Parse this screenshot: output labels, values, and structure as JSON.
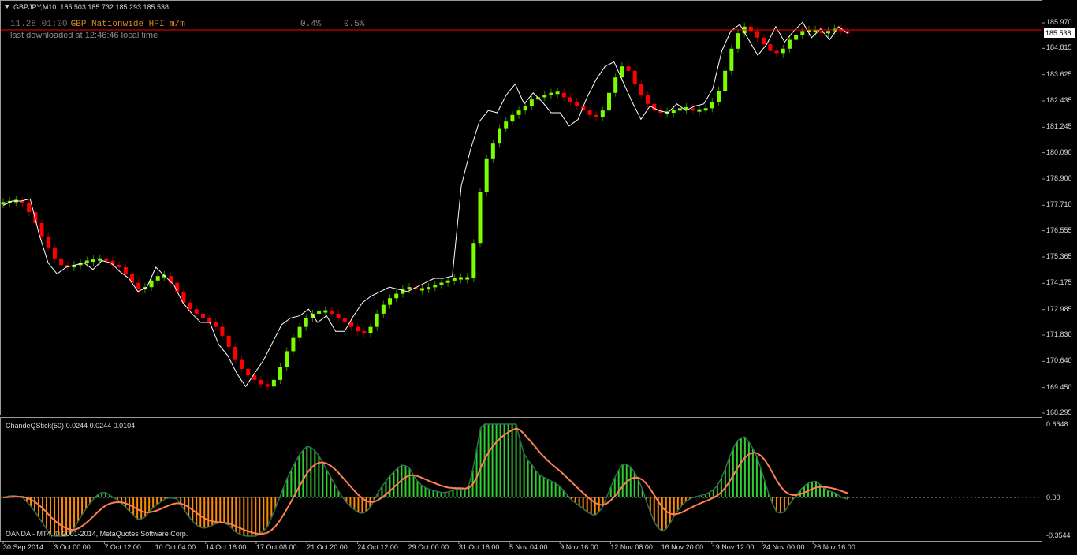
{
  "chart_header": {
    "symbol_timeframe": "GBPJPY,M10",
    "ohlc": "185.503 185.732 185.293 185.538"
  },
  "news": {
    "datetime": "11.28 01:00",
    "event": "GBP Nationwide HPI m/m",
    "actual": "0.4%",
    "forecast": "0.5%"
  },
  "download_status": "last downloaded at 12:46:46 local time",
  "indicator": {
    "name": "ChandeQStick(50)",
    "values": "0.0244 0.0244 0.0104",
    "scale_labels": [
      "0.6648",
      "0.00",
      "-0.3544"
    ]
  },
  "footer": "OANDA - MT4, © 2001-2014, MetaQuotes Software Corp.",
  "current_price": "185.538",
  "colors": {
    "bull": "#7cfc00",
    "bear": "#ff0000",
    "price_line": "#ffffff",
    "bid_line": "#ff0000",
    "hist_pos": "#32cd32",
    "hist_neg": "#ff8c00",
    "signal": "#ff7f50"
  },
  "chart_data": {
    "type": "line",
    "price_axis": [
      185.97,
      184.815,
      183.625,
      182.435,
      181.245,
      180.09,
      178.9,
      177.71,
      176.555,
      175.365,
      174.175,
      172.985,
      171.83,
      170.64,
      169.45,
      168.295
    ],
    "ylim": [
      168.295,
      185.97
    ],
    "time_axis": [
      "30 Sep 2014",
      "3 Oct 00:00",
      "7 Oct 12:00",
      "10 Oct 04:00",
      "14 Oct 16:00",
      "17 Oct 08:00",
      "21 Oct 20:00",
      "24 Oct 12:00",
      "29 Oct 00:00",
      "31 Oct 16:00",
      "5 Nov 04:00",
      "9 Nov 16:00",
      "12 Nov 08:00",
      "16 Nov 20:00",
      "19 Nov 12:00",
      "24 Nov 00:00",
      "26 Nov 16:00"
    ],
    "smoothed_candles": [
      177.8,
      177.9,
      177.9,
      177.8,
      177.4,
      176.9,
      176.3,
      175.8,
      175.3,
      175.0,
      174.9,
      175.0,
      175.1,
      175.2,
      175.2,
      175.3,
      175.2,
      175.0,
      174.9,
      174.6,
      174.2,
      173.9,
      174.0,
      174.3,
      174.5,
      174.5,
      174.2,
      173.8,
      173.3,
      173.0,
      172.8,
      172.6,
      172.4,
      172.2,
      171.8,
      171.3,
      170.7,
      170.3,
      170.0,
      169.8,
      169.6,
      169.5,
      169.8,
      170.4,
      171.1,
      171.7,
      172.2,
      172.6,
      172.8,
      172.9,
      172.9,
      172.8,
      172.6,
      172.4,
      172.2,
      172.0,
      171.9,
      172.2,
      172.8,
      173.2,
      173.5,
      173.7,
      173.9,
      174.0,
      173.9,
      173.9,
      174.0,
      174.1,
      174.2,
      174.3,
      174.4,
      174.4,
      174.4,
      176.0,
      178.3,
      179.8,
      180.5,
      181.2,
      181.5,
      181.8,
      182.0,
      182.2,
      182.5,
      182.6,
      182.7,
      182.8,
      182.8,
      182.6,
      182.4,
      182.2,
      182.0,
      181.8,
      181.7,
      182.0,
      182.8,
      183.5,
      184.0,
      183.8,
      183.2,
      182.7,
      182.3,
      182.0,
      181.9,
      181.9,
      182.0,
      182.1,
      182.1,
      182.0,
      182.0,
      182.1,
      182.4,
      182.9,
      183.8,
      184.8,
      185.5,
      185.8,
      185.6,
      185.3,
      185.0,
      184.7,
      184.6,
      184.8,
      185.2,
      185.4,
      185.6,
      185.6,
      185.6,
      185.5,
      185.6,
      185.7,
      185.6,
      185.5
    ],
    "close_line": [
      177.7,
      177.9,
      177.9,
      178.0,
      176.4,
      175.1,
      174.6,
      174.9,
      175.0,
      175.1,
      174.8,
      175.2,
      175.1,
      174.7,
      174.4,
      173.8,
      174.0,
      174.9,
      174.5,
      174.1,
      173.3,
      172.8,
      172.4,
      172.4,
      171.4,
      170.9,
      170.1,
      169.5,
      170.1,
      170.7,
      171.5,
      172.3,
      172.6,
      172.7,
      173.0,
      172.4,
      172.7,
      172.0,
      172.0,
      172.7,
      173.3,
      173.6,
      173.8,
      174.0,
      173.9,
      173.8,
      174.0,
      174.2,
      174.4,
      174.4,
      174.5,
      178.6,
      180.2,
      181.5,
      182.0,
      181.9,
      182.7,
      183.2,
      182.3,
      182.8,
      182.4,
      181.9,
      181.9,
      181.3,
      181.6,
      182.6,
      183.4,
      184.0,
      184.2,
      183.3,
      182.4,
      181.6,
      182.2,
      182.0,
      181.9,
      182.3,
      182.0,
      182.2,
      182.3,
      183.0,
      184.7,
      185.6,
      185.9,
      185.2,
      184.5,
      185.0,
      185.8,
      185.1,
      185.6,
      186.0,
      185.3,
      185.7,
      185.2,
      185.8,
      185.5
    ],
    "indicator_ylim": [
      -0.3544,
      0.6648
    ]
  }
}
